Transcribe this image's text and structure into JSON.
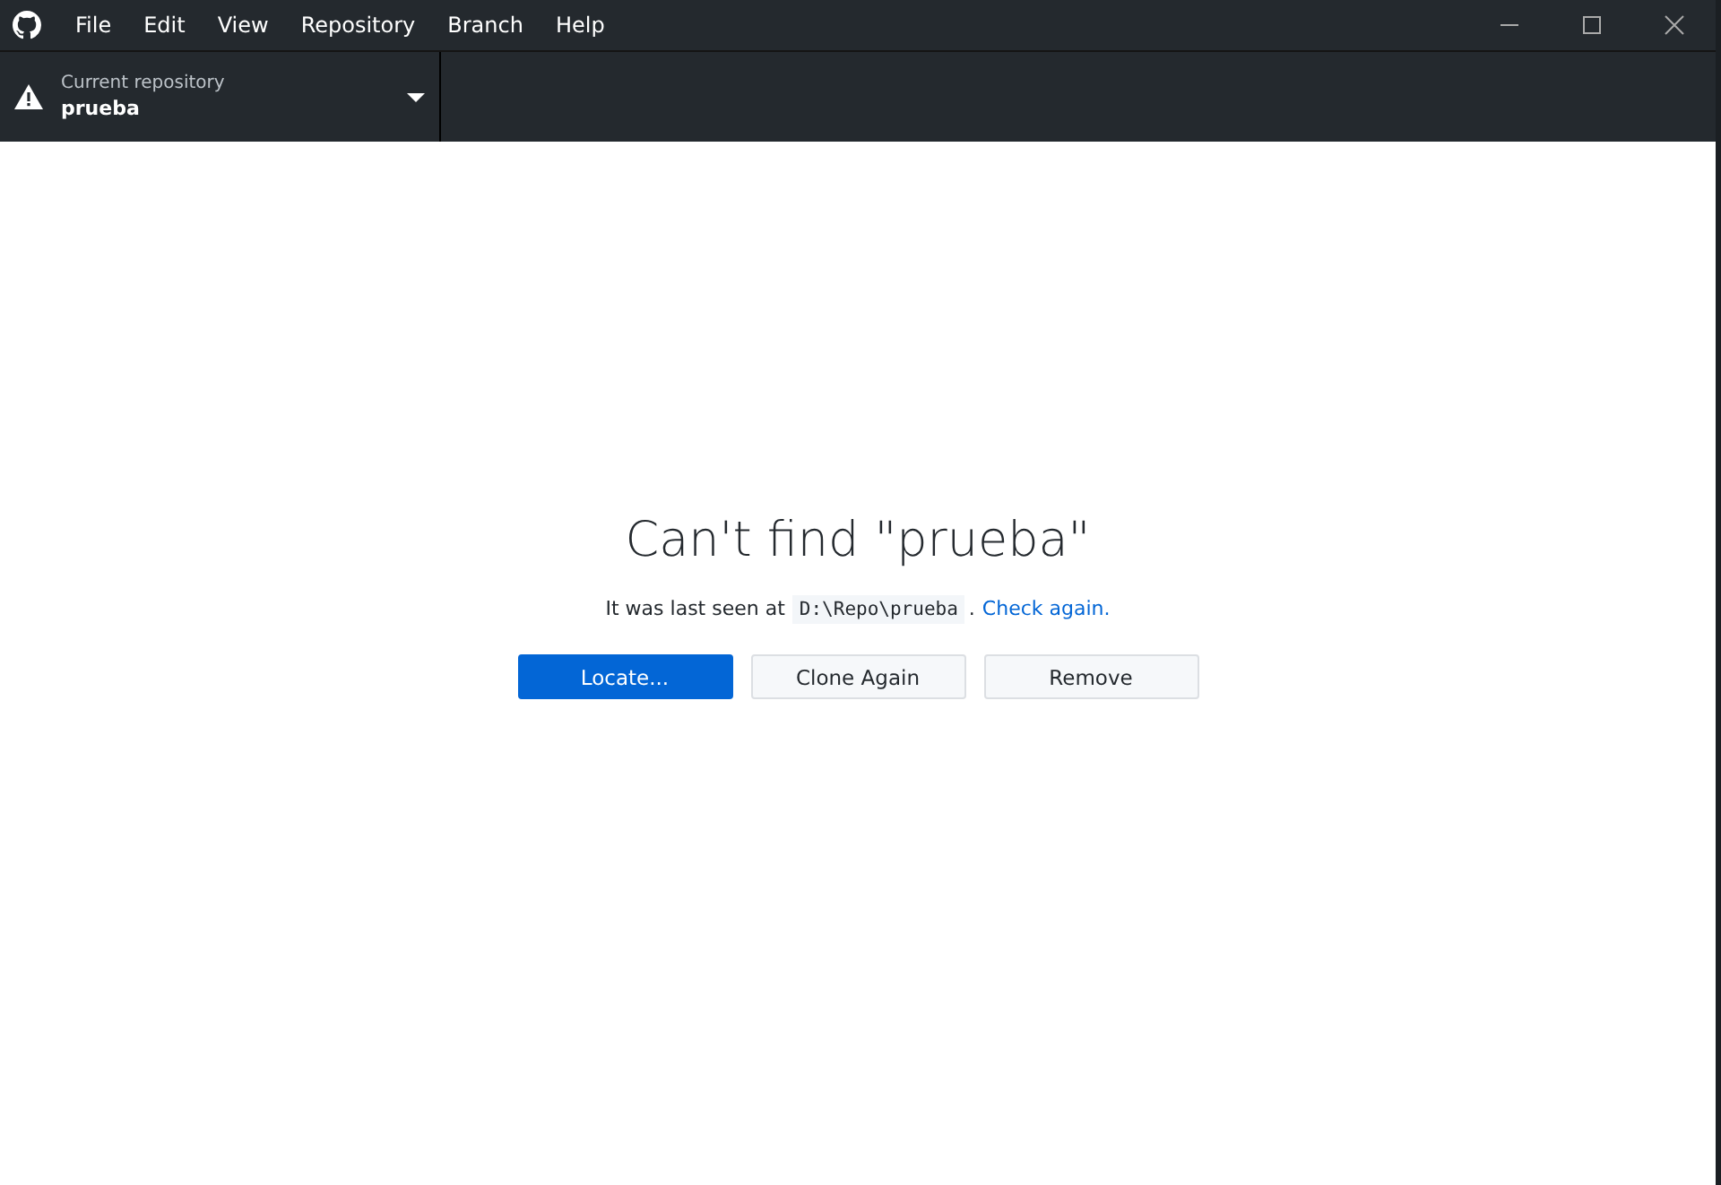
{
  "menu": [
    "File",
    "Edit",
    "View",
    "Repository",
    "Branch",
    "Help"
  ],
  "repository": {
    "label": "Current repository",
    "name": "prueba",
    "warning": true
  },
  "error": {
    "title": "Can't find \"prueba\"",
    "message": "It was last seen at",
    "path": "D:\\Repo\\prueba",
    "separator": ".",
    "link": "Check again."
  },
  "buttons": [
    {
      "label": "Locate...",
      "kind": "primary"
    },
    {
      "label": "Clone Again",
      "kind": "default"
    },
    {
      "label": "Remove",
      "kind": "default"
    }
  ]
}
